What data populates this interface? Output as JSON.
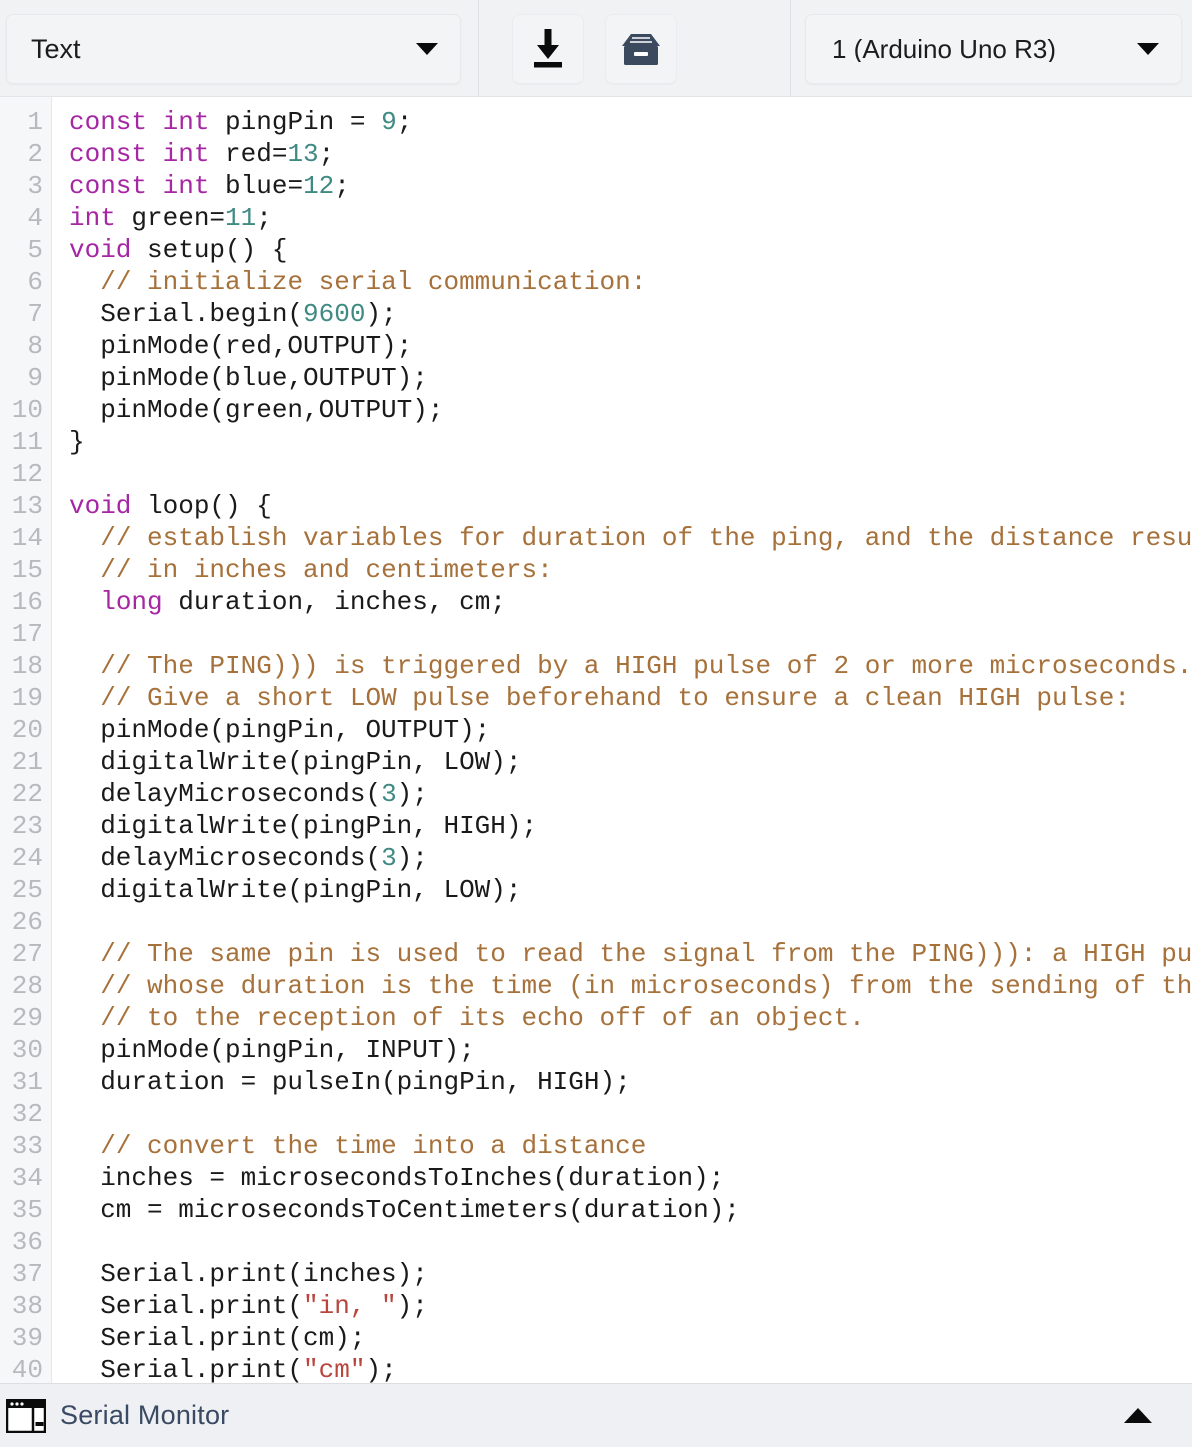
{
  "toolbar": {
    "format_dropdown": {
      "name": "format-select",
      "value": "Text",
      "caret_icon": "chevron-down-icon"
    },
    "upload_button": {
      "name": "upload-button",
      "icon": "download-arrow-icon",
      "tooltip": "Upload"
    },
    "library_button": {
      "name": "library-button",
      "icon": "archive-box-icon",
      "tooltip": "Library"
    },
    "board_dropdown": {
      "name": "board-select",
      "value": "1 (Arduino Uno R3)",
      "caret_icon": "chevron-down-icon"
    },
    "background_color": "#f1f2f4"
  },
  "editor": {
    "language": "arduino-cpp",
    "first_visible_line": 1,
    "last_visible_line": 40,
    "gutter_color": "#f6f7f8",
    "line_number_color": "#b7b9bd",
    "syntax_colors": {
      "keyword": "#a626a4",
      "number": "#3f8a83",
      "comment": "#a6713a",
      "string": "#b9453c",
      "plain": "#1a1a1a"
    },
    "lines": [
      {
        "n": 1,
        "tokens": [
          {
            "t": "kw",
            "s": "const int"
          },
          {
            "t": "pln",
            "s": " pingPin = "
          },
          {
            "t": "num",
            "s": "9"
          },
          {
            "t": "pln",
            "s": ";"
          }
        ]
      },
      {
        "n": 2,
        "tokens": [
          {
            "t": "kw",
            "s": "const int"
          },
          {
            "t": "pln",
            "s": " red="
          },
          {
            "t": "num",
            "s": "13"
          },
          {
            "t": "pln",
            "s": ";"
          }
        ]
      },
      {
        "n": 3,
        "tokens": [
          {
            "t": "kw",
            "s": "const int"
          },
          {
            "t": "pln",
            "s": " blue="
          },
          {
            "t": "num",
            "s": "12"
          },
          {
            "t": "pln",
            "s": ";"
          }
        ]
      },
      {
        "n": 4,
        "tokens": [
          {
            "t": "kw",
            "s": "int"
          },
          {
            "t": "pln",
            "s": " green="
          },
          {
            "t": "num",
            "s": "11"
          },
          {
            "t": "pln",
            "s": ";"
          }
        ]
      },
      {
        "n": 5,
        "tokens": [
          {
            "t": "kw",
            "s": "void"
          },
          {
            "t": "pln",
            "s": " setup() {"
          }
        ]
      },
      {
        "n": 6,
        "tokens": [
          {
            "t": "pln",
            "s": "  "
          },
          {
            "t": "com",
            "s": "// initialize serial communication:"
          }
        ]
      },
      {
        "n": 7,
        "tokens": [
          {
            "t": "pln",
            "s": "  Serial.begin("
          },
          {
            "t": "num",
            "s": "9600"
          },
          {
            "t": "pln",
            "s": ");"
          }
        ]
      },
      {
        "n": 8,
        "tokens": [
          {
            "t": "pln",
            "s": "  pinMode(red,OUTPUT);"
          }
        ]
      },
      {
        "n": 9,
        "tokens": [
          {
            "t": "pln",
            "s": "  pinMode(blue,OUTPUT);"
          }
        ]
      },
      {
        "n": 10,
        "tokens": [
          {
            "t": "pln",
            "s": "  pinMode(green,OUTPUT);"
          }
        ]
      },
      {
        "n": 11,
        "tokens": [
          {
            "t": "pln",
            "s": "}"
          }
        ]
      },
      {
        "n": 12,
        "tokens": [
          {
            "t": "pln",
            "s": ""
          }
        ]
      },
      {
        "n": 13,
        "tokens": [
          {
            "t": "kw",
            "s": "void"
          },
          {
            "t": "pln",
            "s": " loop() {"
          }
        ]
      },
      {
        "n": 14,
        "tokens": [
          {
            "t": "pln",
            "s": "  "
          },
          {
            "t": "com",
            "s": "// establish variables for duration of the ping, and the distance result"
          }
        ]
      },
      {
        "n": 15,
        "tokens": [
          {
            "t": "pln",
            "s": "  "
          },
          {
            "t": "com",
            "s": "// in inches and centimeters:"
          }
        ]
      },
      {
        "n": 16,
        "tokens": [
          {
            "t": "pln",
            "s": "  "
          },
          {
            "t": "kw",
            "s": "long"
          },
          {
            "t": "pln",
            "s": " duration, inches, cm;"
          }
        ]
      },
      {
        "n": 17,
        "tokens": [
          {
            "t": "pln",
            "s": ""
          }
        ]
      },
      {
        "n": 18,
        "tokens": [
          {
            "t": "pln",
            "s": "  "
          },
          {
            "t": "com",
            "s": "// The PING))) is triggered by a HIGH pulse of 2 or more microseconds."
          }
        ]
      },
      {
        "n": 19,
        "tokens": [
          {
            "t": "pln",
            "s": "  "
          },
          {
            "t": "com",
            "s": "// Give a short LOW pulse beforehand to ensure a clean HIGH pulse:"
          }
        ]
      },
      {
        "n": 20,
        "tokens": [
          {
            "t": "pln",
            "s": "  pinMode(pingPin, OUTPUT);"
          }
        ]
      },
      {
        "n": 21,
        "tokens": [
          {
            "t": "pln",
            "s": "  digitalWrite(pingPin, LOW);"
          }
        ]
      },
      {
        "n": 22,
        "tokens": [
          {
            "t": "pln",
            "s": "  delayMicroseconds("
          },
          {
            "t": "num",
            "s": "3"
          },
          {
            "t": "pln",
            "s": ");"
          }
        ]
      },
      {
        "n": 23,
        "tokens": [
          {
            "t": "pln",
            "s": "  digitalWrite(pingPin, HIGH);"
          }
        ]
      },
      {
        "n": 24,
        "tokens": [
          {
            "t": "pln",
            "s": "  delayMicroseconds("
          },
          {
            "t": "num",
            "s": "3"
          },
          {
            "t": "pln",
            "s": ");"
          }
        ]
      },
      {
        "n": 25,
        "tokens": [
          {
            "t": "pln",
            "s": "  digitalWrite(pingPin, LOW);"
          }
        ]
      },
      {
        "n": 26,
        "tokens": [
          {
            "t": "pln",
            "s": ""
          }
        ]
      },
      {
        "n": 27,
        "tokens": [
          {
            "t": "pln",
            "s": "  "
          },
          {
            "t": "com",
            "s": "// The same pin is used to read the signal from the PING))): a HIGH pulse"
          }
        ]
      },
      {
        "n": 28,
        "tokens": [
          {
            "t": "pln",
            "s": "  "
          },
          {
            "t": "com",
            "s": "// whose duration is the time (in microseconds) from the sending of the ping"
          }
        ]
      },
      {
        "n": 29,
        "tokens": [
          {
            "t": "pln",
            "s": "  "
          },
          {
            "t": "com",
            "s": "// to the reception of its echo off of an object."
          }
        ]
      },
      {
        "n": 30,
        "tokens": [
          {
            "t": "pln",
            "s": "  pinMode(pingPin, INPUT);"
          }
        ]
      },
      {
        "n": 31,
        "tokens": [
          {
            "t": "pln",
            "s": "  duration = pulseIn(pingPin, HIGH);"
          }
        ]
      },
      {
        "n": 32,
        "tokens": [
          {
            "t": "pln",
            "s": ""
          }
        ]
      },
      {
        "n": 33,
        "tokens": [
          {
            "t": "pln",
            "s": "  "
          },
          {
            "t": "com",
            "s": "// convert the time into a distance"
          }
        ]
      },
      {
        "n": 34,
        "tokens": [
          {
            "t": "pln",
            "s": "  inches = microsecondsToInches(duration);"
          }
        ]
      },
      {
        "n": 35,
        "tokens": [
          {
            "t": "pln",
            "s": "  cm = microsecondsToCentimeters(duration);"
          }
        ]
      },
      {
        "n": 36,
        "tokens": [
          {
            "t": "pln",
            "s": ""
          }
        ]
      },
      {
        "n": 37,
        "tokens": [
          {
            "t": "pln",
            "s": "  Serial.print(inches);"
          }
        ]
      },
      {
        "n": 38,
        "tokens": [
          {
            "t": "pln",
            "s": "  Serial.print("
          },
          {
            "t": "str",
            "s": "\"in, \""
          },
          {
            "t": "pln",
            "s": ");"
          }
        ]
      },
      {
        "n": 39,
        "tokens": [
          {
            "t": "pln",
            "s": "  Serial.print(cm);"
          }
        ]
      },
      {
        "n": 40,
        "tokens": [
          {
            "t": "pln",
            "s": "  Serial.print("
          },
          {
            "t": "str",
            "s": "\"cm\""
          },
          {
            "t": "pln",
            "s": ");"
          }
        ]
      }
    ]
  },
  "statusbar": {
    "serial_monitor_label": "Serial Monitor",
    "serial_monitor_icon": "panel-window-icon",
    "expand_icon": "chevron-up-icon",
    "background_color": "#eef0f3",
    "label_color": "#3a4a63"
  }
}
